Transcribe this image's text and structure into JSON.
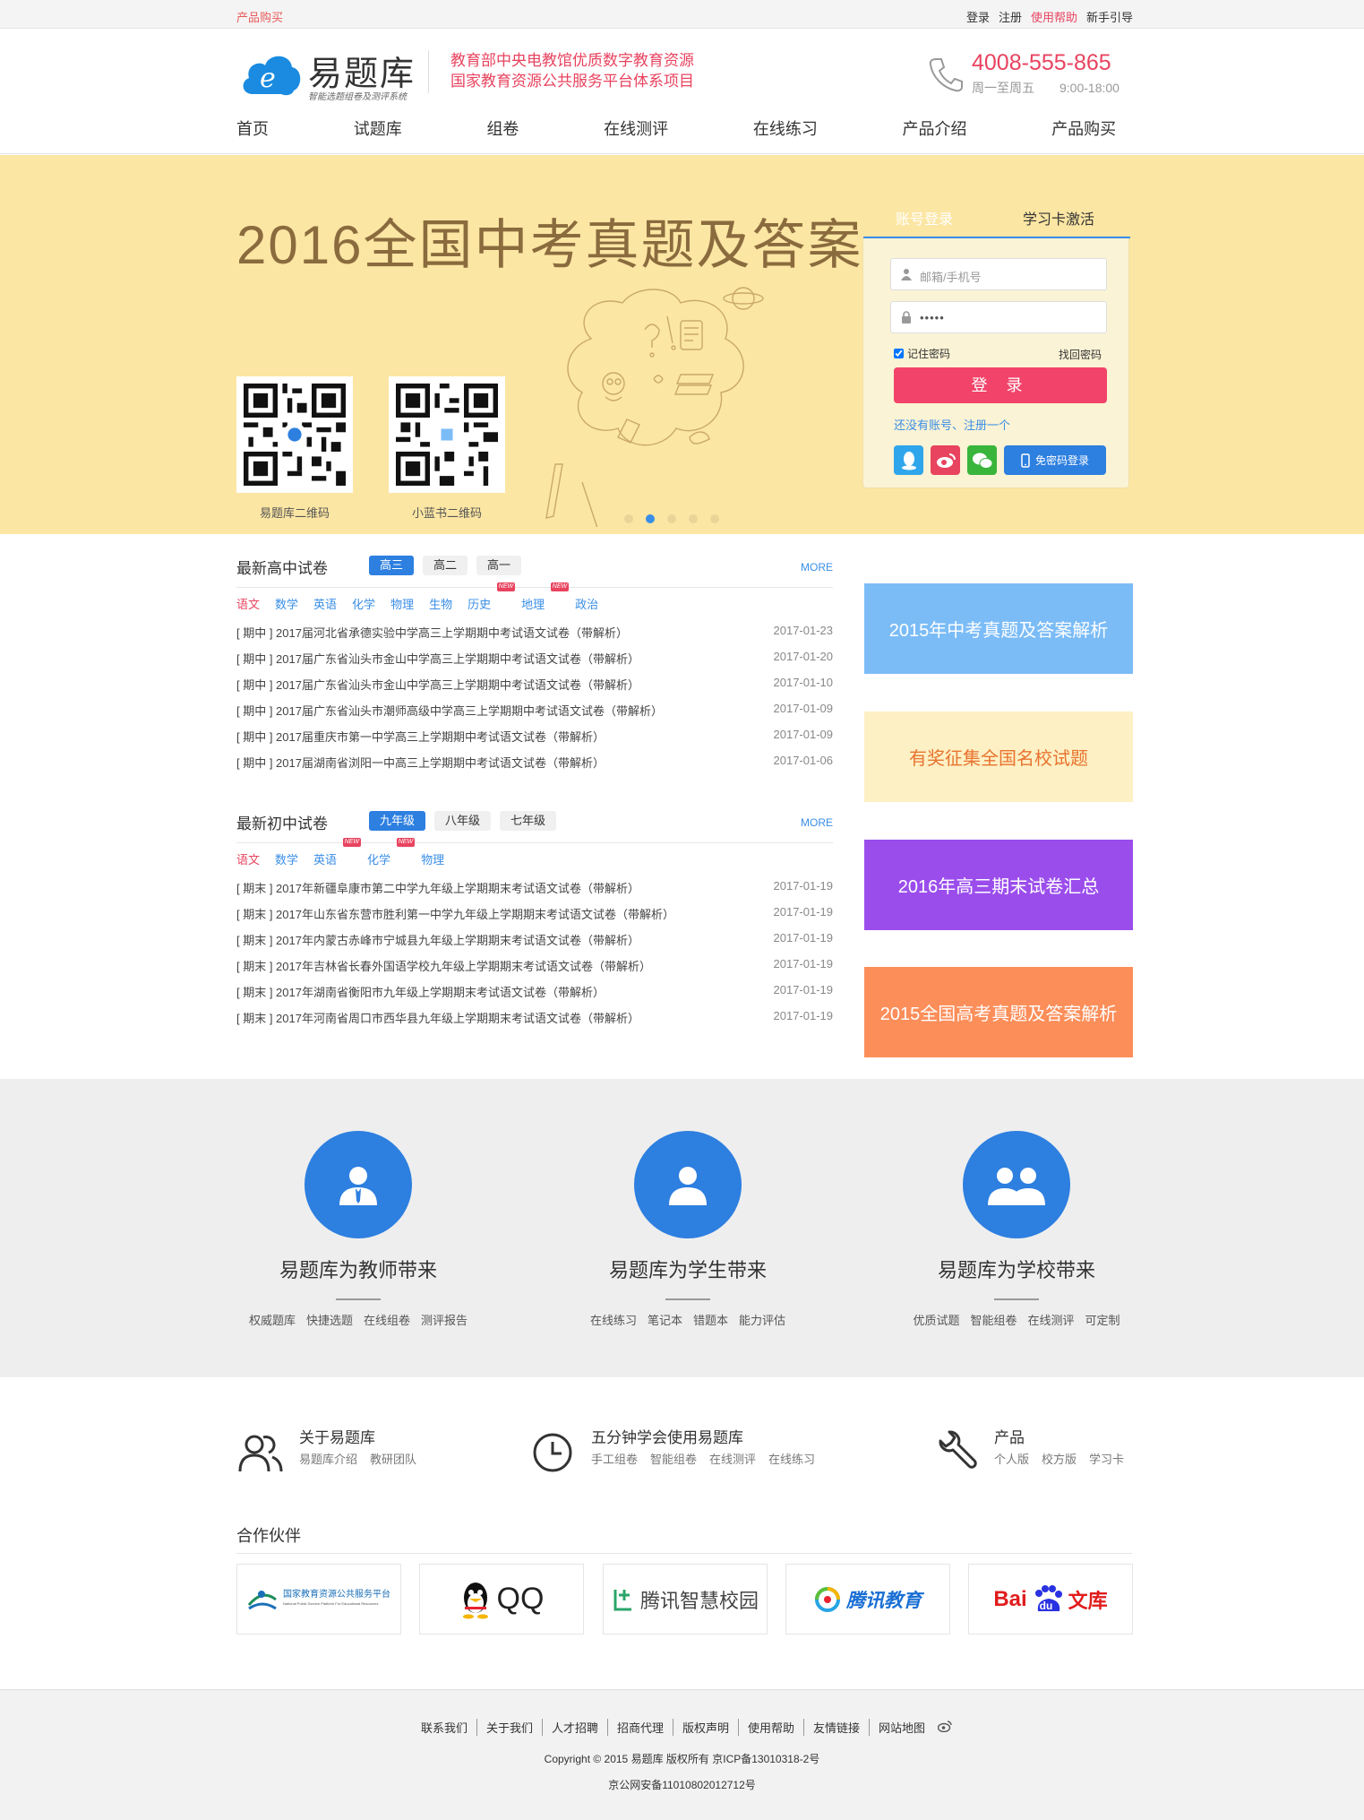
{
  "topbar": {
    "buy": "产品购买",
    "links": [
      "登录",
      "注册",
      "使用帮助",
      "新手引导"
    ]
  },
  "header": {
    "logo_text": "易题库",
    "logo_sub": "智能选题组卷及测评系统",
    "slogan_1": "教育部中央电教馆优质数字教育资源",
    "slogan_2": "国家教育资源公共服务平台体系项目",
    "phone": "4008-555-865",
    "hours": "周一至周五　　9:00-18:00",
    "nav": [
      "首页",
      "试题库",
      "组卷",
      "在线测评",
      "在线练习",
      "产品介绍",
      "产品购买"
    ]
  },
  "banner": {
    "title": "2016全国中考真题及答案",
    "qr1_label": "易题库二维码",
    "qr2_label": "小蓝书二维码",
    "active_slide": 2,
    "slides": 5
  },
  "login": {
    "tab_account": "账号登录",
    "tab_card": "学习卡激活",
    "user_placeholder": "邮箱/手机号",
    "password_mask": "•••••",
    "remember": "记住密码",
    "forgot": "找回密码",
    "submit": "登 录",
    "register": "还没有账号、注册一个",
    "free_login": "免密码登录"
  },
  "senior": {
    "title": "最新高中试卷",
    "grades": [
      "高三",
      "高二",
      "高一"
    ],
    "more": "MORE",
    "subjects": [
      "语文",
      "数学",
      "英语",
      "化学",
      "物理",
      "生物",
      "历史",
      "地理",
      "政治"
    ],
    "items": [
      {
        "text": "[ 期中 ] 2017届河北省承德实验中学高三上学期期中考试语文试卷（带解析）",
        "date": "2017-01-23"
      },
      {
        "text": "[ 期中 ] 2017届广东省汕头市金山中学高三上学期期中考试语文试卷（带解析）",
        "date": "2017-01-20"
      },
      {
        "text": "[ 期中 ] 2017届广东省汕头市金山中学高三上学期期中考试语文试卷（带解析）",
        "date": "2017-01-10"
      },
      {
        "text": "[ 期中 ] 2017届广东省汕头市潮师高级中学高三上学期期中考试语文试卷（带解析）",
        "date": "2017-01-09"
      },
      {
        "text": "[ 期中 ] 2017届重庆市第一中学高三上学期期中考试语文试卷（带解析）",
        "date": "2017-01-09"
      },
      {
        "text": "[ 期中 ] 2017届湖南省浏阳一中高三上学期期中考试语文试卷（带解析）",
        "date": "2017-01-06"
      }
    ]
  },
  "junior": {
    "title": "最新初中试卷",
    "grades": [
      "九年级",
      "八年级",
      "七年级"
    ],
    "more": "MORE",
    "subjects": [
      "语文",
      "数学",
      "英语",
      "化学",
      "物理"
    ],
    "items": [
      {
        "text": "[ 期末 ] 2017年新疆阜康市第二中学九年级上学期期末考试语文试卷（带解析）",
        "date": "2017-01-19"
      },
      {
        "text": "[ 期末 ] 2017年山东省东营市胜利第一中学九年级上学期期末考试语文试卷（带解析）",
        "date": "2017-01-19"
      },
      {
        "text": "[ 期末 ] 2017年内蒙古赤峰市宁城县九年级上学期期末考试语文试卷（带解析）",
        "date": "2017-01-19"
      },
      {
        "text": "[ 期末 ] 2017年吉林省长春外国语学校九年级上学期期末考试语文试卷（带解析）",
        "date": "2017-01-19"
      },
      {
        "text": "[ 期末 ] 2017年湖南省衡阳市九年级上学期期末考试语文试卷（带解析）",
        "date": "2017-01-19"
      },
      {
        "text": "[ 期末 ] 2017年河南省周口市西华县九年级上学期期末考试语文试卷（带解析）",
        "date": "2017-01-19"
      }
    ]
  },
  "new_tag": "NEW",
  "promos": [
    {
      "text": "2015年中考真题及答案解析",
      "bg": "#7bbcf7"
    },
    {
      "text": "有奖征集全国名校试题",
      "bg": "#fdf0c4",
      "color": "#e8732f"
    },
    {
      "text": "2016年高三期末试卷汇总",
      "bg": "#9b4dec"
    },
    {
      "text": "2015全国高考真题及答案解析",
      "bg": "#fc8e5a"
    }
  ],
  "features": [
    {
      "title": "易题库为教师带来",
      "tags": [
        "权威题库",
        "快捷选题",
        "在线组卷",
        "测评报告"
      ]
    },
    {
      "title": "易题库为学生带来",
      "tags": [
        "在线练习",
        "笔记本",
        "错题本",
        "能力评估"
      ]
    },
    {
      "title": "易题库为学校带来",
      "tags": [
        "优质试题",
        "智能组卷",
        "在线测评",
        "可定制"
      ]
    }
  ],
  "info": [
    {
      "title": "关于易题库",
      "links": [
        "易题库介绍",
        "教研团队"
      ]
    },
    {
      "title": "五分钟学会使用易题库",
      "links": [
        "手工组卷",
        "智能组卷",
        "在线测评",
        "在线练习"
      ]
    },
    {
      "title": "产品",
      "links": [
        "个人版",
        "校方版",
        "学习卡"
      ]
    }
  ],
  "partners": {
    "title": "合作伙伴",
    "names": [
      "国家教育资源公共服务平台",
      "National Public Service Platform For Educational Resources",
      "QQ",
      "腾讯智慧校园",
      "腾讯教育",
      "Bai",
      "du",
      "文库"
    ]
  },
  "footer": {
    "links": [
      "联系我们",
      "关于我们",
      "人才招聘",
      "招商代理",
      "版权声明",
      "使用帮助",
      "友情链接",
      "网站地图"
    ],
    "copyright": "Copyright © 2015 易题库 版权所有 京ICP备13010318-2号",
    "icp": "京公网安备11010802012712号"
  },
  "colors": {
    "accent": "#2d7fe0",
    "pink": "#e8435f",
    "banner": "#fce6a3"
  }
}
